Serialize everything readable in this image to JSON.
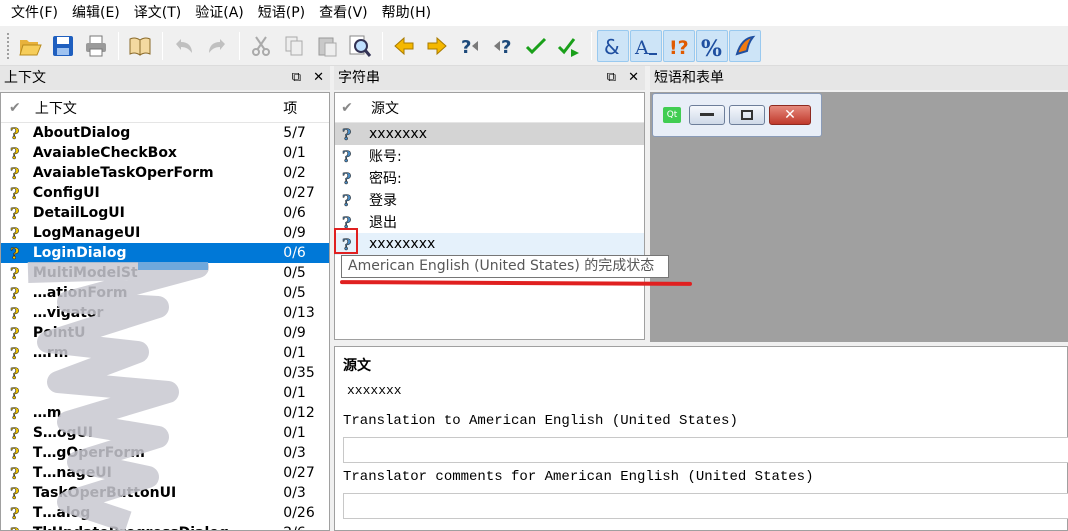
{
  "menubar": {
    "items": [
      "文件(F)",
      "编辑(E)",
      "译文(T)",
      "验证(A)",
      "短语(P)",
      "查看(V)",
      "帮助(H)"
    ]
  },
  "toolbar": {
    "icons": [
      "open-icon",
      "save-icon",
      "print-icon",
      "phrase-book-icon",
      "undo-icon",
      "redo-icon",
      "cut-icon",
      "copy-icon",
      "paste-icon",
      "find-icon",
      "prev-icon",
      "next-icon",
      "prev-unfinished-icon",
      "next-unfinished-icon",
      "done-icon",
      "done-and-next-icon",
      "accelerator-icon",
      "punctuation-icon",
      "phrase-matches-icon",
      "placeholder-icon",
      "surrounding-whitespace-icon"
    ]
  },
  "context_panel": {
    "title": "上下文",
    "col_name": "上下文",
    "col_items": "项",
    "rows": [
      {
        "name": "AboutDialog",
        "items": "5/7"
      },
      {
        "name": "AvaiableCheckBox",
        "items": "0/1"
      },
      {
        "name": "AvaiableTaskOperForm",
        "items": "0/2"
      },
      {
        "name": "ConfigUI",
        "items": "0/27"
      },
      {
        "name": "DetailLogUI",
        "items": "0/6"
      },
      {
        "name": "LogManageUI",
        "items": "0/9"
      },
      {
        "name": "LoginDialog",
        "items": "0/6",
        "selected": true
      },
      {
        "name": "MultiModelSt",
        "items": "0/5"
      },
      {
        "name": "…ationForm",
        "items": "0/5"
      },
      {
        "name": "…vigator",
        "items": "0/13"
      },
      {
        "name": "PointU",
        "items": "0/9"
      },
      {
        "name": "…rm",
        "items": "0/1"
      },
      {
        "name": "",
        "items": "0/35"
      },
      {
        "name": "",
        "items": "0/1"
      },
      {
        "name": "…m",
        "items": "0/12"
      },
      {
        "name": "S…ogUI",
        "items": "0/1"
      },
      {
        "name": "T…gOperForm",
        "items": "0/3"
      },
      {
        "name": "T…nageUI",
        "items": "0/27"
      },
      {
        "name": "TaskOperButtonUI",
        "items": "0/3"
      },
      {
        "name": "T…alog",
        "items": "0/26"
      },
      {
        "name": "TkUpdateProgressDialog",
        "items": "2/6"
      }
    ]
  },
  "strings_panel": {
    "title": "字符串",
    "col_source": "源文",
    "rows": [
      "xxxxxxx",
      "账号:",
      "密码:",
      "登录",
      "退出",
      "xxxxxxxx"
    ]
  },
  "phrases_panel": {
    "title": "短语和表单",
    "qt_logo": "Qt"
  },
  "tooltip": {
    "text": "American English (United States) 的完成状态"
  },
  "editor": {
    "source_label": "源文",
    "source_text": "xxxxxxx",
    "translation_label": "Translation to American English (United States)",
    "comments_label": "Translator comments for American English (United States)"
  },
  "colors": {
    "selection": "#0078d7",
    "annotation_red": "#e02020"
  }
}
